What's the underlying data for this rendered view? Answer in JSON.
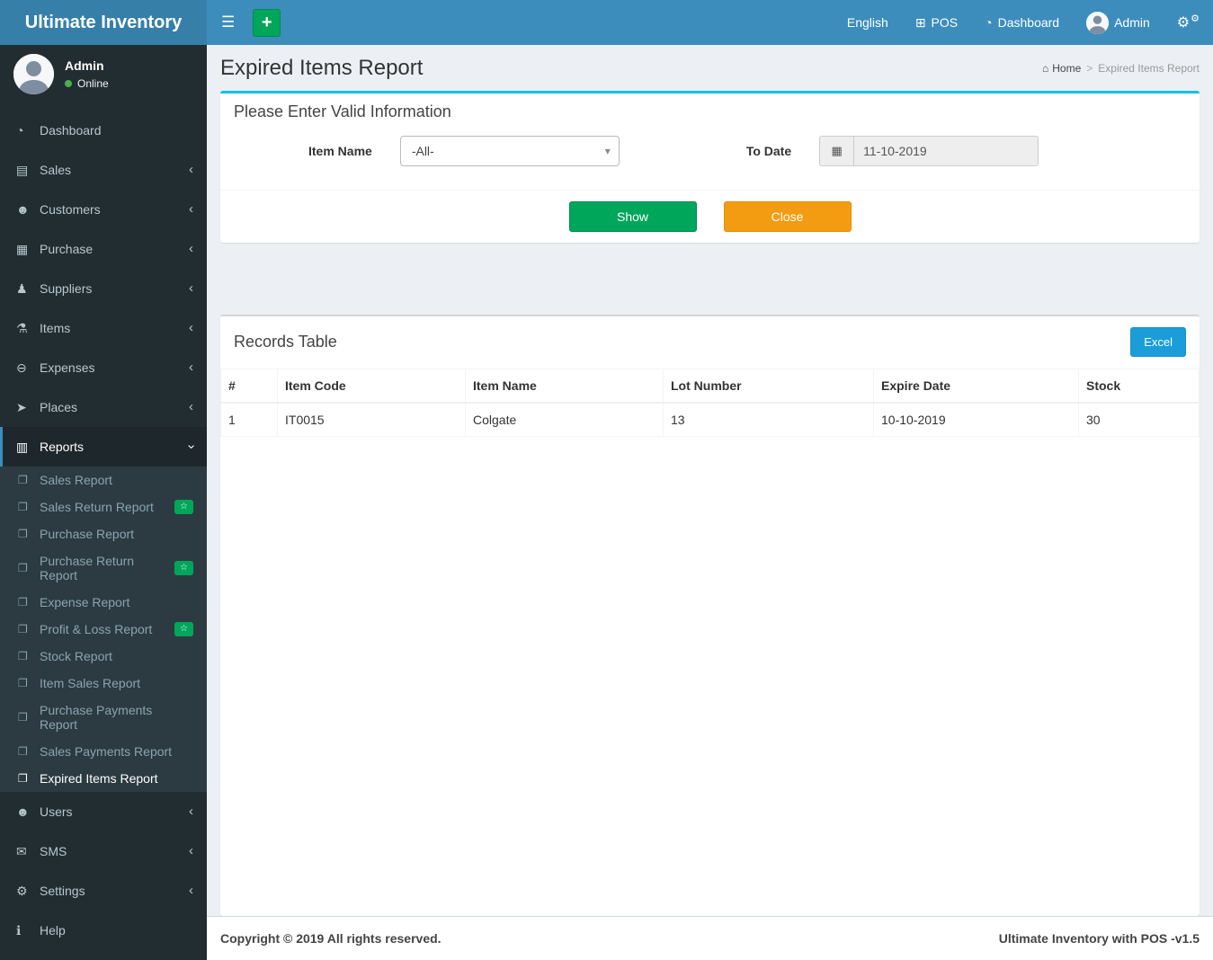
{
  "brand": {
    "title": "Ultimate Inventory"
  },
  "topbar": {
    "language": "English",
    "pos_label": "POS",
    "dashboard_label": "Dashboard",
    "user_name": "Admin"
  },
  "icons": {
    "hamburger": "☰",
    "plus": "+",
    "pos": "⊞",
    "dashboard": "◔",
    "gear": "⚙",
    "home": "⌂",
    "calendar": "▦",
    "caret_down": "▾",
    "chevron": "‹",
    "star": "☆",
    "file": "❐",
    "sales": "▤",
    "customers": "☻",
    "purchase": "▦",
    "suppliers": "♟",
    "items": "⚗",
    "expenses": "⊖",
    "places": "➤",
    "reports": "▥",
    "users": "☻",
    "sms": "✉",
    "settings": "⚙",
    "help": "ℹ",
    "online_dot": "●"
  },
  "sidebar": {
    "user": {
      "name": "Admin",
      "status": "Online"
    },
    "items": [
      {
        "label": "Dashboard"
      },
      {
        "label": "Sales"
      },
      {
        "label": "Customers"
      },
      {
        "label": "Purchase"
      },
      {
        "label": "Suppliers"
      },
      {
        "label": "Items"
      },
      {
        "label": "Expenses"
      },
      {
        "label": "Places"
      },
      {
        "label": "Reports"
      },
      {
        "label": "Users"
      },
      {
        "label": "SMS"
      },
      {
        "label": "Settings"
      },
      {
        "label": "Help"
      }
    ],
    "reports_submenu": [
      {
        "label": "Sales Report",
        "badge": false
      },
      {
        "label": "Sales Return Report",
        "badge": true
      },
      {
        "label": "Purchase Report",
        "badge": false
      },
      {
        "label": "Purchase Return Report",
        "badge": true
      },
      {
        "label": "Expense Report",
        "badge": false
      },
      {
        "label": "Profit & Loss Report",
        "badge": true
      },
      {
        "label": "Stock Report",
        "badge": false
      },
      {
        "label": "Item Sales Report",
        "badge": false
      },
      {
        "label": "Purchase Payments Report",
        "badge": false
      },
      {
        "label": "Sales Payments Report",
        "badge": false
      },
      {
        "label": "Expired Items Report",
        "badge": false,
        "active": true
      }
    ]
  },
  "page": {
    "title": "Expired Items Report",
    "breadcrumb": {
      "home": "Home",
      "separator": ">",
      "current": "Expired Items Report"
    }
  },
  "filter_box": {
    "title": "Please Enter Valid Information",
    "item_name_label": "Item Name",
    "item_name_value": "-All-",
    "to_date_label": "To Date",
    "to_date_value": "11-10-2019",
    "show_button": "Show",
    "close_button": "Close"
  },
  "records": {
    "title": "Records Table",
    "excel_button": "Excel",
    "columns": [
      "#",
      "Item Code",
      "Item Name",
      "Lot Number",
      "Expire Date",
      "Stock"
    ],
    "rows": [
      [
        "1",
        "IT0015",
        "Colgate",
        "13",
        "10-10-2019",
        "30"
      ]
    ]
  },
  "footer": {
    "left": "Copyright © 2019 All rights reserved.",
    "right": "Ultimate Inventory with POS -v1.5"
  },
  "colors": {
    "navbar": "#3c8dbc",
    "logo_bg": "#367fa9",
    "sidebar_bg": "#222d32",
    "submenu_bg": "#2c3b41",
    "green": "#00a65a",
    "orange": "#f39c12",
    "excel_blue": "#1a9dd9",
    "box_accent": "#00c0ef",
    "background": "#ecf0f5"
  }
}
